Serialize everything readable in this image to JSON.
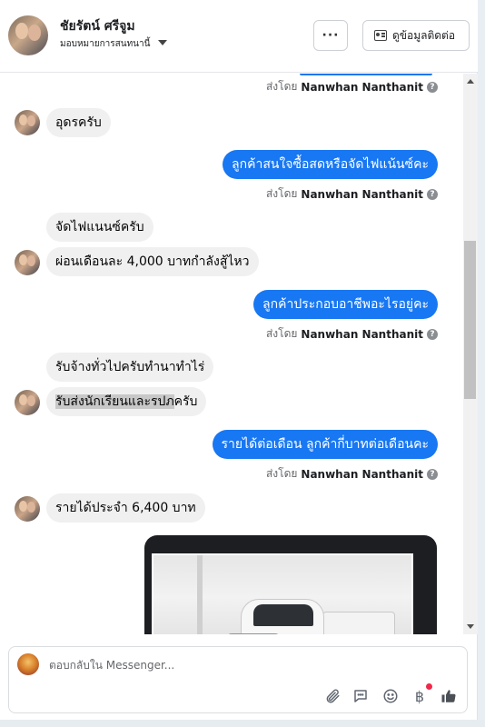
{
  "header": {
    "name": "ชัยรัตน์ ศรีจูม",
    "subtitle": "มอบหมายการสนทนานี้",
    "more_label": "···",
    "contact_label": "ดูข้อมูลติดต่อ"
  },
  "sent_by_prefix": "ส่งโดย",
  "agent_name": "Nanwhan Nanthanit",
  "messages": [
    {
      "text": "อุดรครับ"
    },
    {
      "text": "ลูกค้าสนใจซื้อสดหรือจัดไฟแน้นซ์คะ"
    },
    {
      "text": "จัดไฟแนนซ์ครับ"
    },
    {
      "text": "ผ่อนเดือนละ 4,000 บาทกำลังสู้ไหว"
    },
    {
      "text": "ลูกค้าประกอบอาชีพอะไรอยู่คะ"
    },
    {
      "text": "รับจ้างทั่วไปครับทำนาทำไร่"
    },
    {
      "text_highlight": "รับส่งนักเรียนและรปภ",
      "text_rest": "ครับ"
    },
    {
      "text": "รายได้ต่อเดือน ลูกค้ากี่บาทต่อเดือนคะ"
    },
    {
      "text": "รายได้ประจำ 6,400 บาท"
    }
  ],
  "composer": {
    "placeholder": "ตอบกลับใน Messenger..."
  },
  "icons": {
    "more": "more-icon",
    "contact": "contact-card-icon",
    "info": "info-icon",
    "attach": "paperclip-icon",
    "saved_replies": "chat-bubble-icon",
    "emoji": "emoji-icon",
    "payment": "baht-icon",
    "like": "thumbs-up-icon"
  },
  "colors": {
    "accent": "#1877f2",
    "incoming_bubble": "#f0f0f0",
    "notification": "#f02849"
  }
}
